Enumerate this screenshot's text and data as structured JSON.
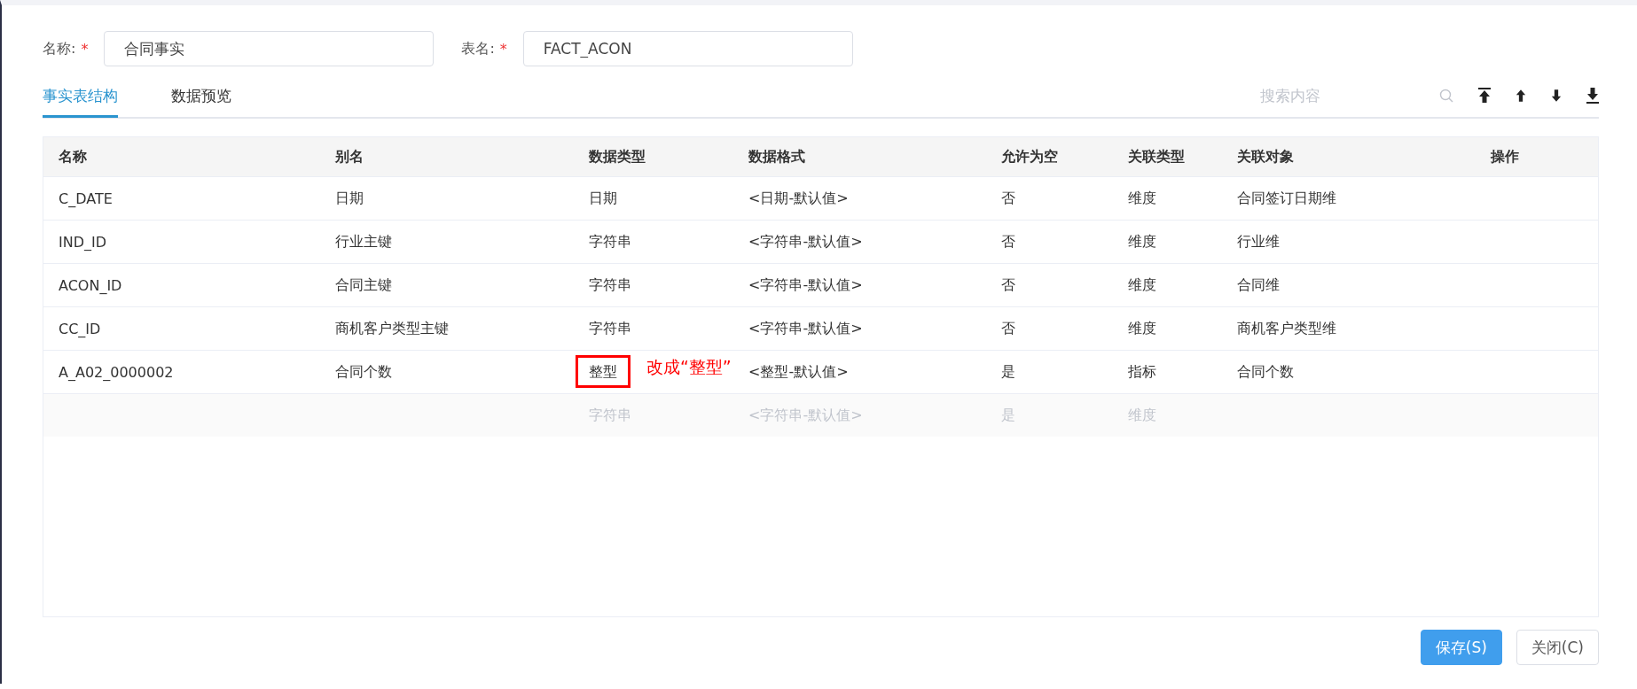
{
  "form": {
    "name_label": "名称:",
    "name_value": "合同事实",
    "table_label": "表名:",
    "table_value": "FACT_ACON",
    "required_mark": "*"
  },
  "tabs": [
    {
      "label": "事实表结构",
      "selected": true
    },
    {
      "label": "数据预览",
      "selected": false
    }
  ],
  "search": {
    "placeholder": "搜索内容"
  },
  "table": {
    "columns": [
      "名称",
      "别名",
      "数据类型",
      "数据格式",
      "允许为空",
      "关联类型",
      "关联对象",
      "操作"
    ],
    "rows": [
      {
        "cells": [
          "C_DATE",
          "日期",
          "日期",
          "<日期-默认值>",
          "否",
          "维度",
          "合同签订日期维",
          ""
        ],
        "disabled": false
      },
      {
        "cells": [
          "IND_ID",
          "行业主键",
          "字符串",
          "<字符串-默认值>",
          "否",
          "维度",
          "行业维",
          ""
        ],
        "disabled": false
      },
      {
        "cells": [
          "ACON_ID",
          "合同主键",
          "字符串",
          "<字符串-默认值>",
          "否",
          "维度",
          "合同维",
          ""
        ],
        "disabled": false
      },
      {
        "cells": [
          "CC_ID",
          "商机客户类型主键",
          "字符串",
          "<字符串-默认值>",
          "否",
          "维度",
          "商机客户类型维",
          ""
        ],
        "disabled": false
      },
      {
        "cells": [
          "A_A02_0000002",
          "合同个数",
          "整型",
          "<整型-默认值>",
          "是",
          "指标",
          "合同个数",
          ""
        ],
        "disabled": false,
        "note": "改成“整型”"
      },
      {
        "cells": [
          "",
          "",
          "字符串",
          "<字符串-默认值>",
          "是",
          "维度",
          "",
          ""
        ],
        "disabled": true
      }
    ]
  },
  "buttons": [
    {
      "label": "保存(S)",
      "kind": "primary"
    },
    {
      "label": "关闭(C)",
      "kind": "default"
    }
  ]
}
